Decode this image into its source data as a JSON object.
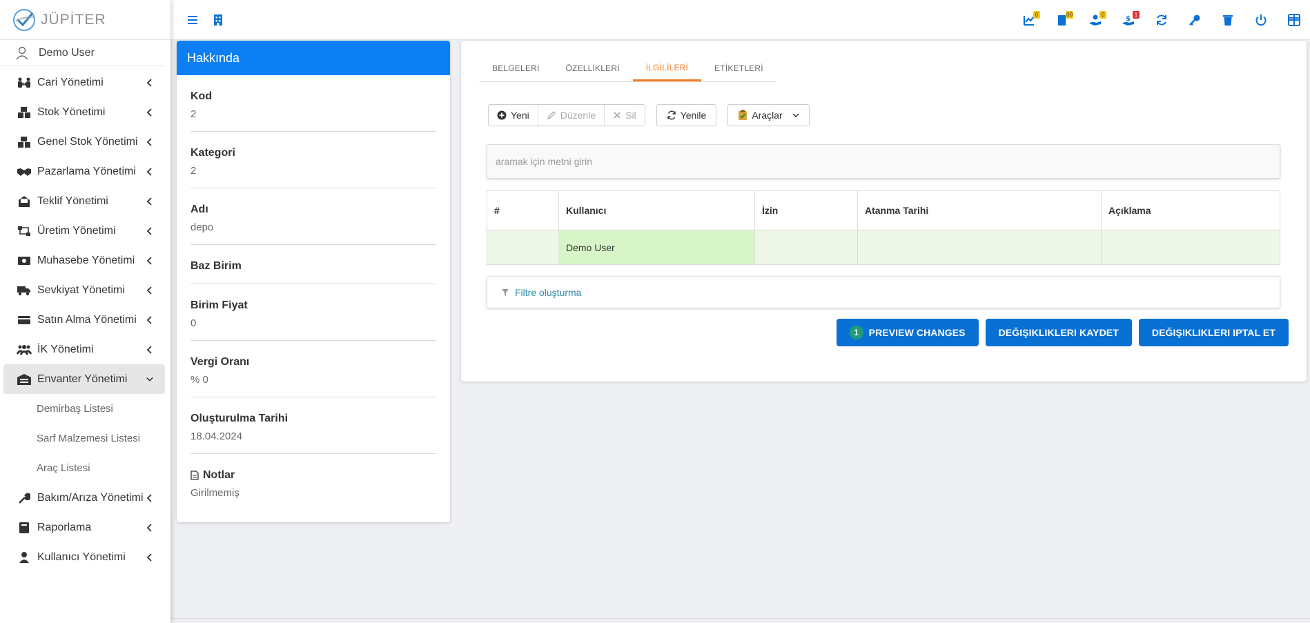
{
  "app": {
    "name": "JÜPİTER"
  },
  "user": {
    "name": "Demo User"
  },
  "sidebar": {
    "items": [
      {
        "label": "Cari Yönetimi"
      },
      {
        "label": "Stok Yönetimi"
      },
      {
        "label": "Genel Stok Yönetimi"
      },
      {
        "label": "Pazarlama Yönetimi"
      },
      {
        "label": "Teklif Yönetimi"
      },
      {
        "label": "Üretim Yönetimi"
      },
      {
        "label": "Muhasebe Yönetimi"
      },
      {
        "label": "Sevkiyat Yönetimi"
      },
      {
        "label": "Satın Alma Yönetimi"
      },
      {
        "label": "İK Yönetimi"
      },
      {
        "label": "Envanter Yönetimi"
      },
      {
        "label": "Bakım/Arıza Yönetimi"
      },
      {
        "label": "Raporlama"
      },
      {
        "label": "Kullanıcı Yönetimi"
      }
    ],
    "subitems": [
      {
        "label": "Demirbaş Listesi"
      },
      {
        "label": "Sarf Malzemesi Listesi"
      },
      {
        "label": "Araç Listesi"
      }
    ]
  },
  "topbar": {
    "badges": {
      "b1": "0",
      "b2": "00",
      "b3": "0",
      "b4": "1"
    },
    "badge_colors": {
      "yellow": "#f5c518",
      "red": "#e03131"
    },
    "accent": "#0a71d4"
  },
  "about": {
    "title": "Hakkında",
    "fields": [
      {
        "label": "Kod",
        "value": "2"
      },
      {
        "label": "Kategori",
        "value": "2"
      },
      {
        "label": "Adı",
        "value": "depo"
      },
      {
        "label": "Baz Birim",
        "value": ""
      },
      {
        "label": "Birim Fiyat",
        "value": "0"
      },
      {
        "label": "Vergi Oranı",
        "value": "% 0"
      },
      {
        "label": "Oluşturulma Tarihi",
        "value": "18.04.2024"
      },
      {
        "label": "Notlar",
        "value": "Girilmemiş"
      }
    ]
  },
  "tabs": [
    {
      "label": "BELGELERİ"
    },
    {
      "label": "ÖZELLİKLERİ"
    },
    {
      "label": "İLGİLİLERİ"
    },
    {
      "label": "ETİKETLERİ"
    }
  ],
  "toolbar": {
    "new": "Yeni",
    "edit": "Düzenle",
    "delete": "Sil",
    "refresh": "Yenile",
    "tools": "Araçlar"
  },
  "search": {
    "placeholder": "aramak için metni girin"
  },
  "grid": {
    "columns": [
      "#",
      "Kullanıcı",
      "İzin",
      "Atanma Tarihi",
      "Açıklama"
    ],
    "rows": [
      [
        "",
        "Demo User",
        "",
        "",
        ""
      ]
    ]
  },
  "filter": {
    "label": "Filtre oluşturma"
  },
  "actions": {
    "preview_count": "1",
    "preview": "PREVIEW CHANGES",
    "save": "DEĞIŞIKLIKLERI KAYDET",
    "cancel": "DEĞIŞIKLIKLERI IPTAL ET"
  }
}
